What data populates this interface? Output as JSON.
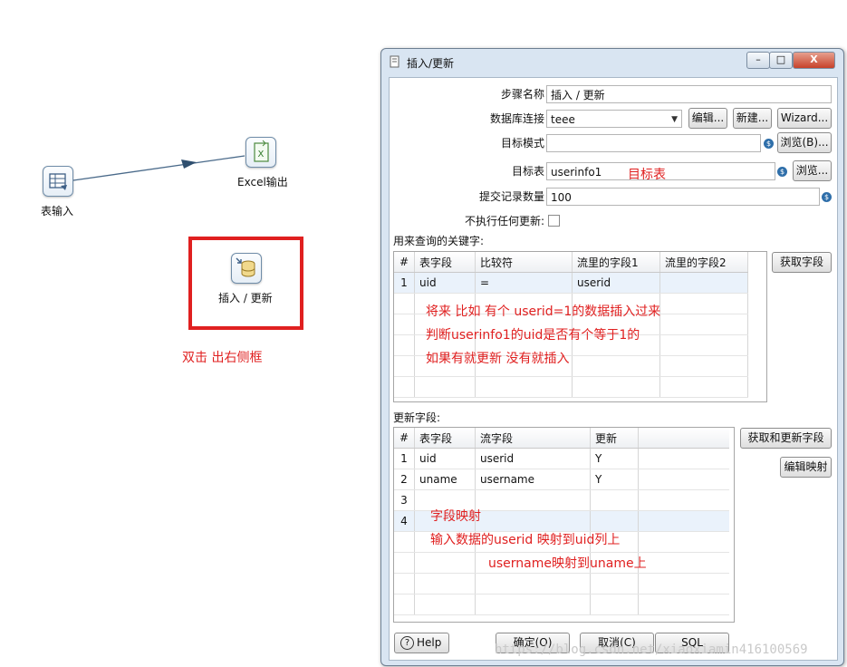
{
  "canvas": {
    "nodes": {
      "table_input": "表输入",
      "excel_output": "Excel输出",
      "insert_update": "插入 / 更新"
    },
    "excel_icon_letter": "X",
    "annotation": "双击 出右侧框",
    "highlight_color": "#e02020"
  },
  "dialog": {
    "title": "插入/更新",
    "window_buttons": {
      "minimize": "–",
      "maximize": "□",
      "close": "X"
    },
    "fields": {
      "step_name_label": "步骤名称",
      "step_name_value": "插入 / 更新",
      "db_connection_label": "数据库连接",
      "db_connection_value": "teee",
      "edit_button": "编辑...",
      "new_button": "新建...",
      "wizard_button": "Wizard...",
      "target_schema_label": "目标模式",
      "target_schema_value": "",
      "browse_schema_button": "浏览(B)...",
      "target_table_label": "目标表",
      "target_table_value": "userinfo1",
      "target_table_note": "目标表",
      "browse_table_button": "浏览...",
      "commit_size_label": "提交记录数量",
      "commit_size_value": "100",
      "no_update_label": "不执行任何更新:",
      "no_update_checked": false
    },
    "lookup": {
      "section_label": "用来查询的关键字:",
      "get_fields_button": "获取字段",
      "columns": [
        "#",
        "表字段",
        "比较符",
        "流里的字段1",
        "流里的字段2"
      ],
      "rows": [
        [
          "1",
          "uid",
          "=",
          "userid",
          ""
        ]
      ],
      "notes": [
        "将来 比如 有个 userid=1的数据插入过来",
        "判断userinfo1的uid是否有个等于1的",
        "如果有就更新  没有就插入"
      ]
    },
    "update": {
      "section_label": "更新字段:",
      "get_update_fields_button": "获取和更新字段",
      "edit_mapping_button": "编辑映射",
      "columns": [
        "#",
        "表字段",
        "流字段",
        "更新"
      ],
      "rows": [
        [
          "1",
          "uid",
          "userid",
          "Y"
        ],
        [
          "2",
          "uname",
          "username",
          "Y"
        ],
        [
          "3",
          "",
          "",
          ""
        ],
        [
          "4",
          "",
          "",
          ""
        ]
      ],
      "notes": [
        "字段映射",
        "输入数据的userid 映射到uid列上",
        "username映射到uname上"
      ]
    },
    "footer": {
      "help_button": "Help",
      "help_icon": "?",
      "ok_button": "确定(O)",
      "cancel_button": "取消(C)",
      "sql_button": "SQL"
    },
    "watermark": "https://blog.csdn.net/xiaoxiamin416100569"
  }
}
